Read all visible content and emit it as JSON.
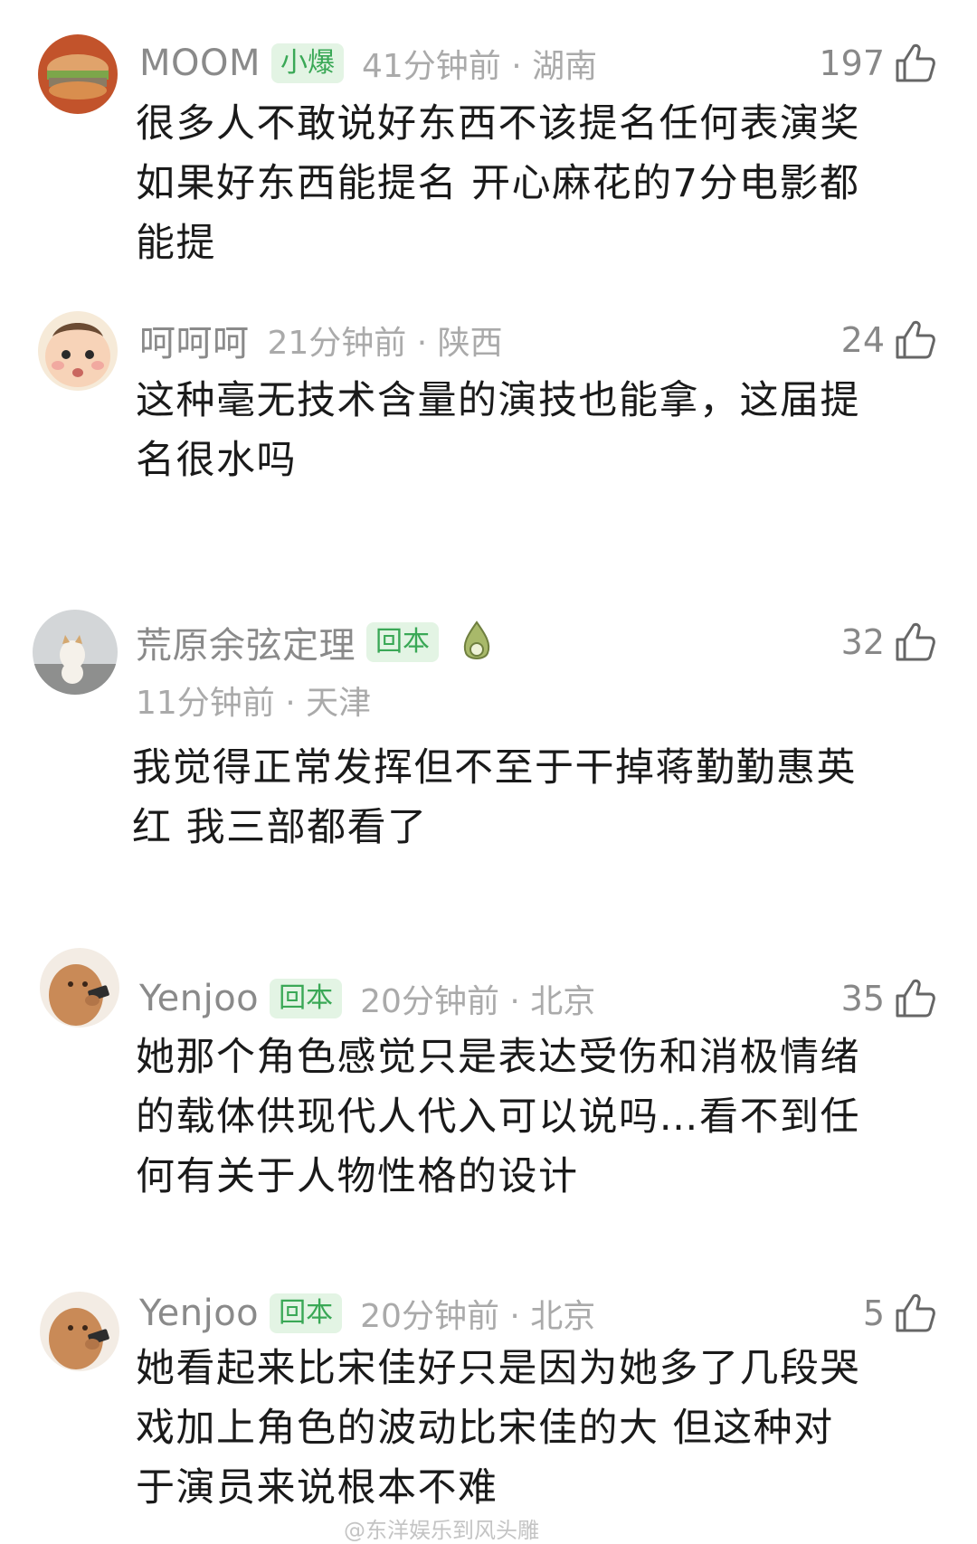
{
  "comments": [
    {
      "username": "MOOM",
      "badge": "小爆",
      "time_location": "41分钟前 · 湖南",
      "likes": "197",
      "avatar_icon": "burger-avatar",
      "lines": [
        "很多人不敢说好东西不该提名任何表演奖",
        "如果好东西能提名 开心麻花的7分电影都",
        "能提"
      ]
    },
    {
      "username": "呵呵呵",
      "time_location": "21分钟前 · 陕西",
      "likes": "24",
      "avatar_icon": "baby-face-avatar",
      "lines": [
        "这种毫无技术含量的演技也能拿，这届提",
        "名很水吗"
      ]
    },
    {
      "username": "荒原余弦定理",
      "badge": "回本",
      "time_location": "11分钟前 · 天津",
      "likes": "32",
      "avatar_icon": "cat-avatar",
      "badge_icon": "leaf-medal-icon",
      "lines": [
        "我觉得正常发挥但不至于干掉蒋勤勤惠英",
        "红 我三部都看了"
      ]
    },
    {
      "username": "Yenjoo",
      "badge": "回本",
      "time_location": "20分钟前 · 北京",
      "likes": "35",
      "avatar_icon": "cartoon-phone-avatar",
      "lines": [
        "她那个角色感觉只是表达受伤和消极情绪",
        "的载体供现代人代入可以说吗…看不到任",
        "何有关于人物性格的设计"
      ]
    },
    {
      "username": "Yenjoo",
      "badge": "回本",
      "time_location": "20分钟前 · 北京",
      "likes": "5",
      "avatar_icon": "cartoon-phone-avatar",
      "lines": [
        "她看起来比宋佳好只是因为她多了几段哭",
        "戏加上角色的波动比宋佳的大 但这种对",
        "于演员来说根本不难"
      ]
    }
  ],
  "watermark": "@东洋娱乐到风头雕",
  "colors": {
    "username": "#8a8a8a",
    "badge_text": "#3aa856",
    "badge_bg": "#e3f4e4",
    "meta_text": "#aaaaaa",
    "body_text": "#1a1a1a"
  }
}
